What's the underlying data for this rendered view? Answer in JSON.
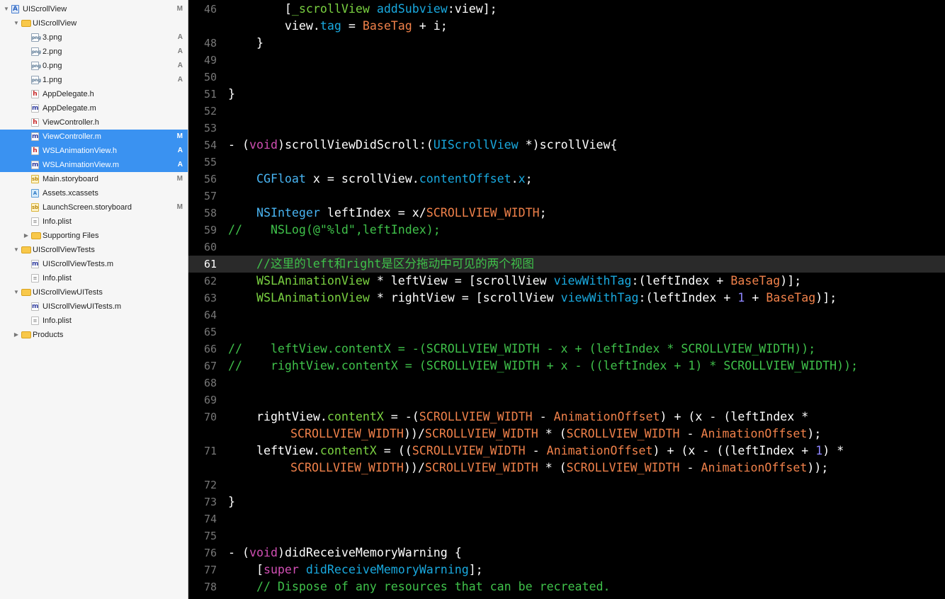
{
  "navigator": {
    "items": [
      {
        "label": "UIScrollView",
        "status": "M",
        "icon": "project-icon",
        "indent": 0,
        "disclosure": "expanded",
        "selected": false
      },
      {
        "label": "UIScrollView",
        "status": "",
        "icon": "folder-icon",
        "indent": 1,
        "disclosure": "expanded",
        "selected": false
      },
      {
        "label": "3.png",
        "status": "A",
        "icon": "png-file-icon",
        "indent": 2,
        "disclosure": "",
        "selected": false
      },
      {
        "label": "2.png",
        "status": "A",
        "icon": "png-file-icon",
        "indent": 2,
        "disclosure": "",
        "selected": false
      },
      {
        "label": "0.png",
        "status": "A",
        "icon": "png-file-icon",
        "indent": 2,
        "disclosure": "",
        "selected": false
      },
      {
        "label": "1.png",
        "status": "A",
        "icon": "png-file-icon",
        "indent": 2,
        "disclosure": "",
        "selected": false
      },
      {
        "label": "AppDelegate.h",
        "status": "",
        "icon": "header-file-icon",
        "indent": 2,
        "disclosure": "",
        "selected": false
      },
      {
        "label": "AppDelegate.m",
        "status": "",
        "icon": "objc-file-icon",
        "indent": 2,
        "disclosure": "",
        "selected": false
      },
      {
        "label": "ViewController.h",
        "status": "",
        "icon": "header-file-icon",
        "indent": 2,
        "disclosure": "",
        "selected": false
      },
      {
        "label": "ViewController.m",
        "status": "M",
        "icon": "objc-file-icon",
        "indent": 2,
        "disclosure": "",
        "selected": true
      },
      {
        "label": "WSLAnimationView.h",
        "status": "A",
        "icon": "header-file-icon",
        "indent": 2,
        "disclosure": "",
        "selected": true
      },
      {
        "label": "WSLAnimationView.m",
        "status": "A",
        "icon": "objc-file-icon",
        "indent": 2,
        "disclosure": "",
        "selected": true
      },
      {
        "label": "Main.storyboard",
        "status": "M",
        "icon": "storyboard-icon",
        "indent": 2,
        "disclosure": "",
        "selected": false
      },
      {
        "label": "Assets.xcassets",
        "status": "",
        "icon": "asset-catalog-icon",
        "indent": 2,
        "disclosure": "",
        "selected": false
      },
      {
        "label": "LaunchScreen.storyboard",
        "status": "M",
        "icon": "storyboard-icon",
        "indent": 2,
        "disclosure": "",
        "selected": false
      },
      {
        "label": "Info.plist",
        "status": "",
        "icon": "plist-file-icon",
        "indent": 2,
        "disclosure": "",
        "selected": false
      },
      {
        "label": "Supporting Files",
        "status": "",
        "icon": "folder-icon",
        "indent": 2,
        "disclosure": "collapsed",
        "selected": false
      },
      {
        "label": "UIScrollViewTests",
        "status": "",
        "icon": "folder-icon",
        "indent": 1,
        "disclosure": "expanded",
        "selected": false
      },
      {
        "label": "UIScrollViewTests.m",
        "status": "",
        "icon": "objc-file-icon",
        "indent": 2,
        "disclosure": "",
        "selected": false
      },
      {
        "label": "Info.plist",
        "status": "",
        "icon": "plist-file-icon",
        "indent": 2,
        "disclosure": "",
        "selected": false
      },
      {
        "label": "UIScrollViewUITests",
        "status": "",
        "icon": "folder-icon",
        "indent": 1,
        "disclosure": "expanded",
        "selected": false
      },
      {
        "label": "UIScrollViewUITests.m",
        "status": "",
        "icon": "objc-file-icon",
        "indent": 2,
        "disclosure": "",
        "selected": false
      },
      {
        "label": "Info.plist",
        "status": "",
        "icon": "plist-file-icon",
        "indent": 2,
        "disclosure": "",
        "selected": false
      },
      {
        "label": "Products",
        "status": "",
        "icon": "folder-icon",
        "indent": 1,
        "disclosure": "collapsed",
        "selected": false
      }
    ]
  },
  "editor": {
    "current_line": 61,
    "lines": [
      {
        "n": "46",
        "wrapped": false,
        "tokens": [
          [
            "        [",
            "plain"
          ],
          [
            "_scrollView",
            "ivar"
          ],
          [
            " ",
            "plain"
          ],
          [
            "addSubview",
            "method"
          ],
          [
            ":view];",
            "plain"
          ]
        ]
      },
      {
        "n": "",
        "wrapped": false,
        "tokens": [
          [
            "        view.",
            "plain"
          ],
          [
            "tag",
            "method"
          ],
          [
            " = ",
            "plain"
          ],
          [
            "BaseTag",
            "macro"
          ],
          [
            " + i;",
            "plain"
          ]
        ]
      },
      {
        "n": "48",
        "wrapped": false,
        "tokens": [
          [
            "    }",
            "plain"
          ]
        ]
      },
      {
        "n": "49",
        "wrapped": false,
        "tokens": []
      },
      {
        "n": "50",
        "wrapped": false,
        "tokens": []
      },
      {
        "n": "51",
        "wrapped": false,
        "tokens": [
          [
            "}",
            "plain"
          ]
        ]
      },
      {
        "n": "52",
        "wrapped": false,
        "tokens": []
      },
      {
        "n": "53",
        "wrapped": false,
        "tokens": []
      },
      {
        "n": "54",
        "wrapped": false,
        "tokens": [
          [
            "- (",
            "plain"
          ],
          [
            "void",
            "keyword"
          ],
          [
            ")scrollViewDidScroll:(",
            "plain"
          ],
          [
            "UIScrollView",
            "type"
          ],
          [
            " *)scrollView{",
            "plain"
          ]
        ]
      },
      {
        "n": "55",
        "wrapped": false,
        "tokens": []
      },
      {
        "n": "56",
        "wrapped": false,
        "tokens": [
          [
            "    ",
            "plain"
          ],
          [
            "CGFloat",
            "ctype"
          ],
          [
            " x = scrollView.",
            "plain"
          ],
          [
            "contentOffset",
            "method"
          ],
          [
            ".",
            "plain"
          ],
          [
            "x",
            "method"
          ],
          [
            ";",
            "plain"
          ]
        ]
      },
      {
        "n": "57",
        "wrapped": false,
        "tokens": []
      },
      {
        "n": "58",
        "wrapped": false,
        "tokens": [
          [
            "    ",
            "plain"
          ],
          [
            "NSInteger",
            "ctype"
          ],
          [
            " leftIndex = x/",
            "plain"
          ],
          [
            "SCROLLVIEW_WIDTH",
            "macro"
          ],
          [
            ";",
            "plain"
          ]
        ]
      },
      {
        "n": "59",
        "wrapped": false,
        "tokens": [
          [
            "//    NSLog(@\"%ld\",leftIndex);",
            "comment"
          ]
        ]
      },
      {
        "n": "60",
        "wrapped": false,
        "tokens": []
      },
      {
        "n": "61",
        "wrapped": false,
        "tokens": [
          [
            "    //这里的left和right是区分拖动中可见的两个视图",
            "comment"
          ]
        ]
      },
      {
        "n": "62",
        "wrapped": false,
        "tokens": [
          [
            "    ",
            "plain"
          ],
          [
            "WSLAnimationView",
            "ivar"
          ],
          [
            " * leftView = [scrollView ",
            "plain"
          ],
          [
            "viewWithTag",
            "method"
          ],
          [
            ":(leftIndex + ",
            "plain"
          ],
          [
            "BaseTag",
            "macro"
          ],
          [
            ")];",
            "plain"
          ]
        ]
      },
      {
        "n": "63",
        "wrapped": false,
        "tokens": [
          [
            "    ",
            "plain"
          ],
          [
            "WSLAnimationView",
            "ivar"
          ],
          [
            " * rightView = [scrollView ",
            "plain"
          ],
          [
            "viewWithTag",
            "method"
          ],
          [
            ":(leftIndex + ",
            "plain"
          ],
          [
            "1",
            "number"
          ],
          [
            " + ",
            "plain"
          ],
          [
            "BaseTag",
            "macro"
          ],
          [
            ")];",
            "plain"
          ]
        ]
      },
      {
        "n": "64",
        "wrapped": false,
        "tokens": []
      },
      {
        "n": "65",
        "wrapped": false,
        "tokens": []
      },
      {
        "n": "66",
        "wrapped": false,
        "tokens": [
          [
            "//    leftView.contentX = -(SCROLLVIEW_WIDTH - x + (leftIndex * SCROLLVIEW_WIDTH));",
            "comment"
          ]
        ]
      },
      {
        "n": "67",
        "wrapped": false,
        "tokens": [
          [
            "//    rightView.contentX = (SCROLLVIEW_WIDTH + x - ((leftIndex + 1) * SCROLLVIEW_WIDTH));",
            "comment"
          ]
        ]
      },
      {
        "n": "68",
        "wrapped": false,
        "tokens": []
      },
      {
        "n": "69",
        "wrapped": false,
        "tokens": []
      },
      {
        "n": "70",
        "wrapped": false,
        "tokens": [
          [
            "    rightView.",
            "plain"
          ],
          [
            "contentX",
            "ivar"
          ],
          [
            " = -(",
            "plain"
          ],
          [
            "SCROLLVIEW_WIDTH",
            "macro"
          ],
          [
            " - ",
            "plain"
          ],
          [
            "AnimationOffset",
            "macro"
          ],
          [
            ") + (x - (leftIndex *",
            "plain"
          ]
        ]
      },
      {
        "n": "",
        "wrapped": true,
        "tokens": [
          [
            "SCROLLVIEW_WIDTH",
            "macro"
          ],
          [
            "))/",
            "plain"
          ],
          [
            "SCROLLVIEW_WIDTH",
            "macro"
          ],
          [
            " * (",
            "plain"
          ],
          [
            "SCROLLVIEW_WIDTH",
            "macro"
          ],
          [
            " - ",
            "plain"
          ],
          [
            "AnimationOffset",
            "macro"
          ],
          [
            ");",
            "plain"
          ]
        ]
      },
      {
        "n": "71",
        "wrapped": false,
        "tokens": [
          [
            "    leftView.",
            "plain"
          ],
          [
            "contentX",
            "ivar"
          ],
          [
            " = ((",
            "plain"
          ],
          [
            "SCROLLVIEW_WIDTH",
            "macro"
          ],
          [
            " - ",
            "plain"
          ],
          [
            "AnimationOffset",
            "macro"
          ],
          [
            ") + (x - ((leftIndex + ",
            "plain"
          ],
          [
            "1",
            "number"
          ],
          [
            ") *",
            "plain"
          ]
        ]
      },
      {
        "n": "",
        "wrapped": true,
        "tokens": [
          [
            "SCROLLVIEW_WIDTH",
            "macro"
          ],
          [
            "))/",
            "plain"
          ],
          [
            "SCROLLVIEW_WIDTH",
            "macro"
          ],
          [
            " * (",
            "plain"
          ],
          [
            "SCROLLVIEW_WIDTH",
            "macro"
          ],
          [
            " - ",
            "plain"
          ],
          [
            "AnimationOffset",
            "macro"
          ],
          [
            "));",
            "plain"
          ]
        ]
      },
      {
        "n": "72",
        "wrapped": false,
        "tokens": []
      },
      {
        "n": "73",
        "wrapped": false,
        "tokens": [
          [
            "}",
            "plain"
          ]
        ]
      },
      {
        "n": "74",
        "wrapped": false,
        "tokens": []
      },
      {
        "n": "75",
        "wrapped": false,
        "tokens": []
      },
      {
        "n": "76",
        "wrapped": false,
        "tokens": [
          [
            "- (",
            "plain"
          ],
          [
            "void",
            "keyword"
          ],
          [
            ")didReceiveMemoryWarning {",
            "plain"
          ]
        ]
      },
      {
        "n": "77",
        "wrapped": false,
        "tokens": [
          [
            "    [",
            "plain"
          ],
          [
            "super",
            "keyword"
          ],
          [
            " ",
            "plain"
          ],
          [
            "didReceiveMemoryWarning",
            "method"
          ],
          [
            "];",
            "plain"
          ]
        ]
      },
      {
        "n": "78",
        "wrapped": false,
        "tokens": [
          [
            "    // Dispose of any resources that can be recreated.",
            "comment"
          ]
        ]
      }
    ]
  }
}
